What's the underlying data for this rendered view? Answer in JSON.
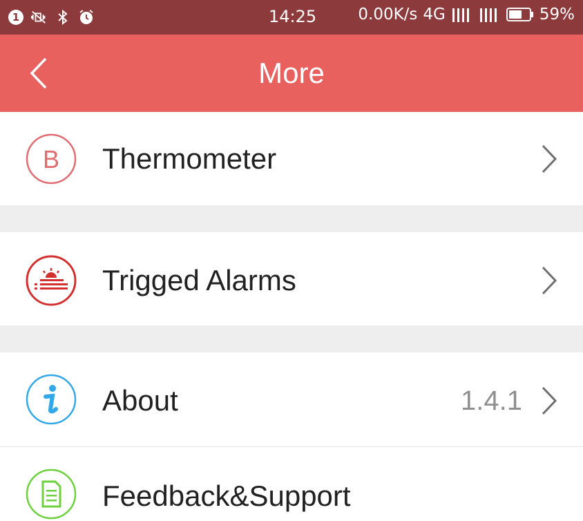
{
  "status_bar": {
    "notification_count": "1",
    "time": "14:25",
    "network_speed": "0.00K/s",
    "network_type": "4G",
    "battery_percent": "59%"
  },
  "header": {
    "title": "More",
    "background": "#e9615f"
  },
  "items": [
    {
      "label": "Thermometer",
      "icon": "thermometer-icon",
      "icon_letter": "B",
      "color": "#e06c72"
    },
    {
      "label": "Trigged Alarms",
      "icon": "alarm-icon",
      "color": "#d32f2f"
    },
    {
      "label": "About",
      "value": "1.4.1",
      "icon": "info-icon",
      "color": "#33a8e8"
    },
    {
      "label": "Feedback&Support",
      "icon": "document-icon",
      "color": "#6cd13c"
    }
  ]
}
